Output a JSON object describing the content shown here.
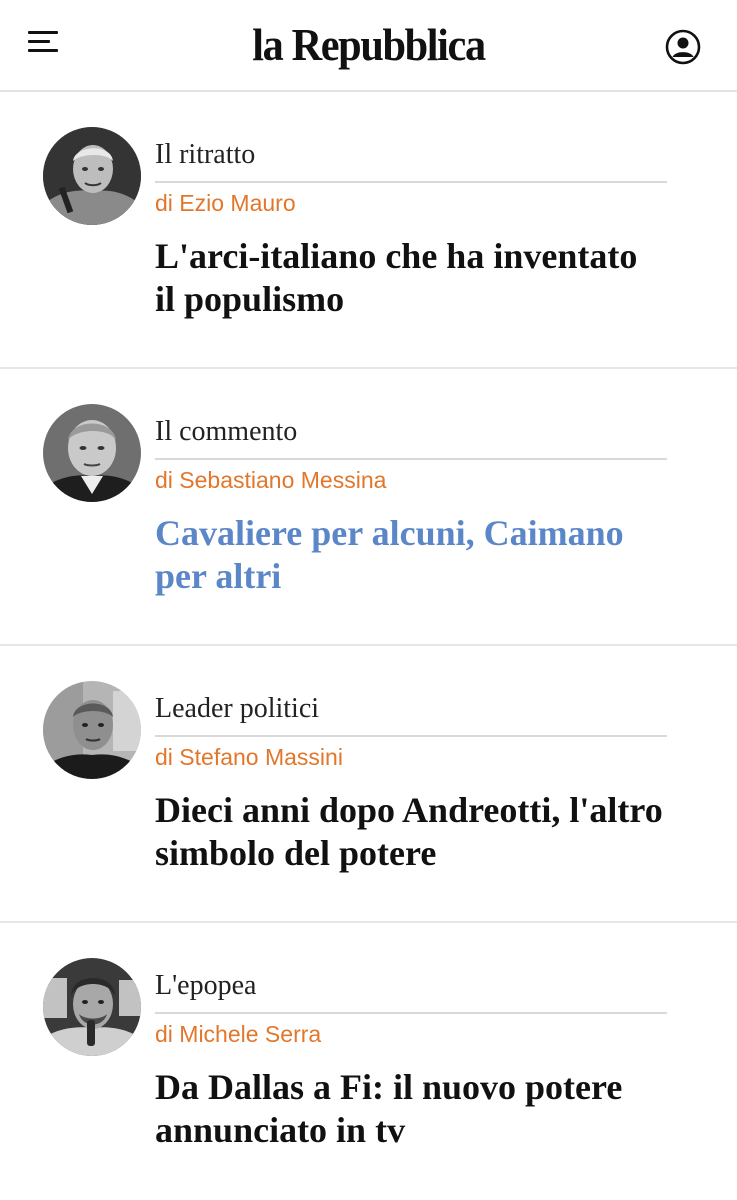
{
  "header": {
    "logo": "la Repubblica",
    "menu_icon": "hamburger-menu-icon",
    "account_icon": "user-account-icon"
  },
  "colors": {
    "author": "#e2772b",
    "visited_headline": "#5b87c9",
    "headline": "#111111"
  },
  "articles": [
    {
      "kicker": "Il ritratto",
      "author": "di Ezio Mauro",
      "headline_line1": "L'arci-italiano che ha inventato",
      "headline_line2": "il populismo",
      "visited": false,
      "avatar": "author-photo-ezio-mauro"
    },
    {
      "kicker": "Il commento",
      "author": "di Sebastiano Messina",
      "headline_line1": "Cavaliere per alcuni, Caimano",
      "headline_line2": "per altri",
      "visited": true,
      "avatar": "author-photo-sebastiano-messina"
    },
    {
      "kicker": "Leader politici",
      "author": "di Stefano Massini",
      "headline_line1": "Dieci anni dopo Andreotti, l'altro",
      "headline_line2": "simbolo del potere",
      "visited": false,
      "avatar": "author-photo-stefano-massini"
    },
    {
      "kicker": "L'epopea",
      "author": "di Michele Serra",
      "headline_line1": "Da Dallas a Fi: il nuovo potere",
      "headline_line2": "annunciato in tv",
      "visited": false,
      "avatar": "author-photo-michele-serra"
    }
  ]
}
